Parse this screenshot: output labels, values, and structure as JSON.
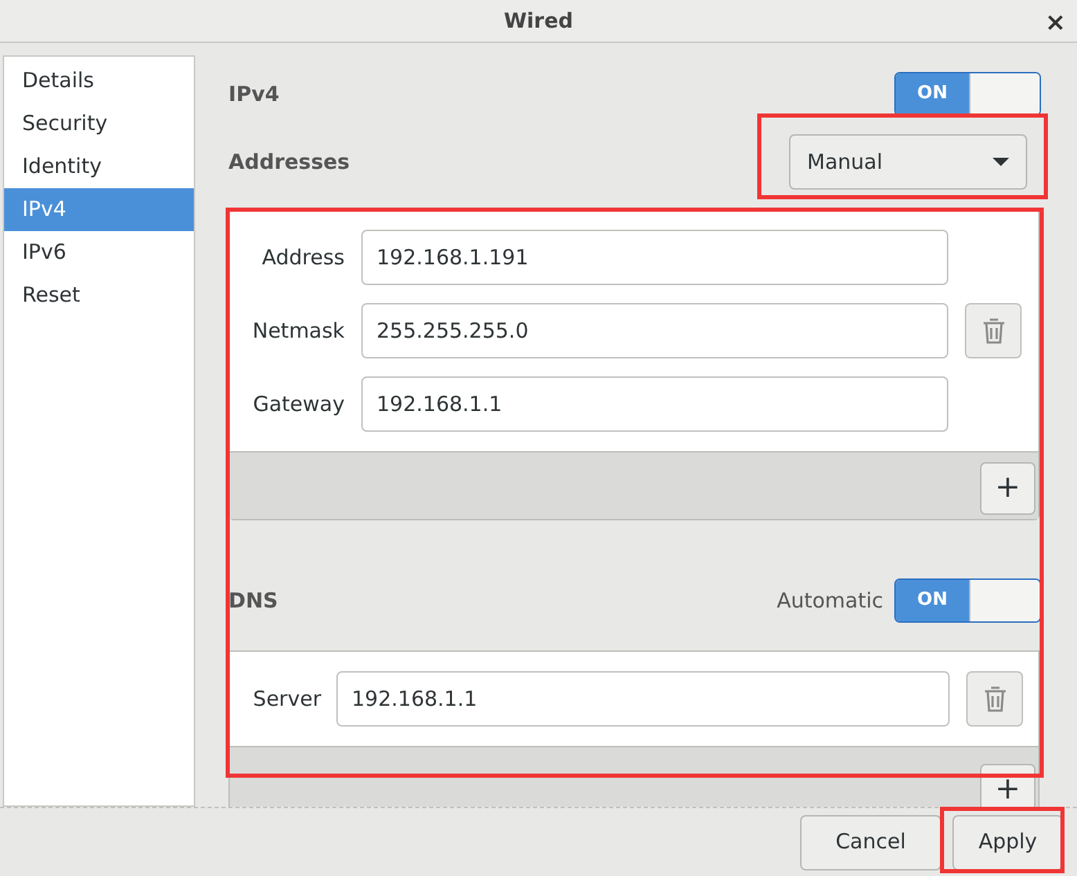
{
  "window": {
    "title": "Wired",
    "close": "×"
  },
  "sidebar": {
    "items": [
      {
        "label": "Details",
        "selected": false
      },
      {
        "label": "Security",
        "selected": false
      },
      {
        "label": "Identity",
        "selected": false
      },
      {
        "label": "IPv4",
        "selected": true
      },
      {
        "label": "IPv6",
        "selected": false
      },
      {
        "label": "Reset",
        "selected": false
      }
    ]
  },
  "ipv4": {
    "label": "IPv4",
    "switch": {
      "on": true,
      "text": "ON"
    }
  },
  "addresses": {
    "label": "Addresses",
    "method": "Manual",
    "fields": [
      {
        "label": "Address",
        "value": "192.168.1.191",
        "removable": false
      },
      {
        "label": "Netmask",
        "value": "255.255.255.0",
        "removable": true
      },
      {
        "label": "Gateway",
        "value": "192.168.1.1",
        "removable": false
      }
    ],
    "add": "+"
  },
  "dns": {
    "label": "DNS",
    "automatic_label": "Automatic",
    "switch": {
      "on": true,
      "text": "ON"
    },
    "fields": [
      {
        "label": "Server",
        "value": "192.168.1.1",
        "removable": true
      }
    ],
    "add": "+"
  },
  "buttons": [
    {
      "label": "Cancel",
      "kind": "cancel"
    },
    {
      "label": "Apply",
      "kind": "apply"
    }
  ]
}
